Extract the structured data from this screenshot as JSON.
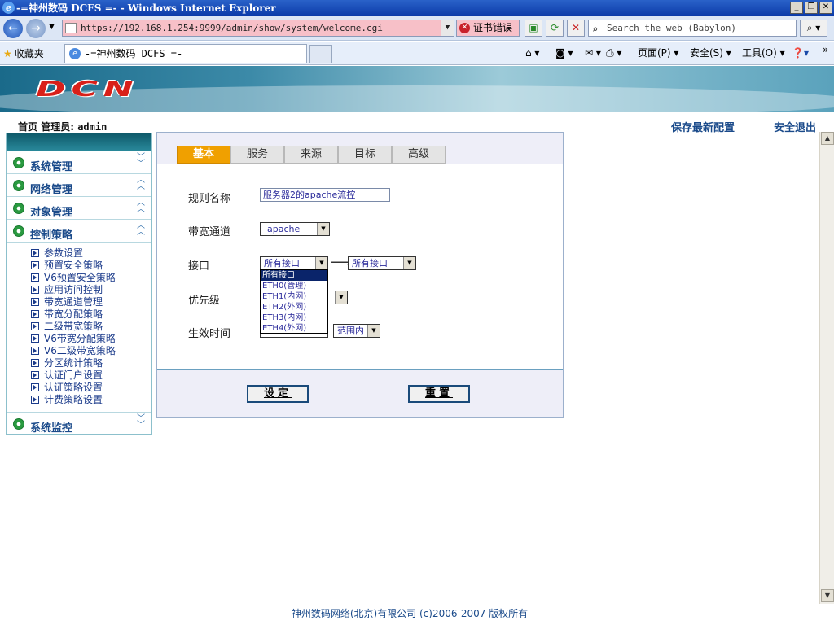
{
  "browser": {
    "title": "-=神州数码 DCFS =- - Windows Internet Explorer",
    "url": "https://192.168.1.254:9999/admin/show/system/welcome.cgi",
    "cert_error": "证书错误",
    "search_placeholder": "Search the web (Babylon)",
    "favorites": "收藏夹",
    "tab_title": "-=神州数码 DCFS =-",
    "cmd_page": "页面(P)",
    "cmd_safety": "安全(S)",
    "cmd_tools": "工具(O)"
  },
  "header": {
    "logo": "DCN",
    "home": "首页",
    "admin_label": "管理员:",
    "admin_name": "admin",
    "save_config": "保存最新配置",
    "logout": "安全退出"
  },
  "sidebar": {
    "sections": [
      {
        "label": "系统管理"
      },
      {
        "label": "网络管理"
      },
      {
        "label": "对象管理"
      },
      {
        "label": "控制策略"
      },
      {
        "label": "系统监控"
      }
    ],
    "items": [
      "参数设置",
      "预置安全策略",
      "V6预置安全策略",
      "应用访问控制",
      "带宽通道管理",
      "带宽分配策略",
      "二级带宽策略",
      "V6带宽分配策略",
      "V6二级带宽策略",
      "分区统计策略",
      "认证门户设置",
      "认证策略设置",
      "计费策略设置"
    ]
  },
  "form": {
    "tabs": [
      "基本",
      "服务",
      "来源",
      "目标",
      "高级"
    ],
    "rule_name_label": "规则名称",
    "rule_name_value": "服务器2的apache流控",
    "channel_label": "带宽通道",
    "channel_value": "apache",
    "interface_label": "接口",
    "interface_in": "所有接口",
    "interface_out": "所有接口",
    "interface_options": [
      "所有接口",
      "ETH0(管理)",
      "ETH1(内网)",
      "ETH2(外网)",
      "ETH3(内网)",
      "ETH4(外网)"
    ],
    "priority_label": "优先级",
    "time_label": "生效时间",
    "time_range": "范围内",
    "set_button": "设定",
    "reset_button": "重置"
  },
  "footer": "神州数码网络(北京)有限公司 (c)2006-2007 版权所有"
}
